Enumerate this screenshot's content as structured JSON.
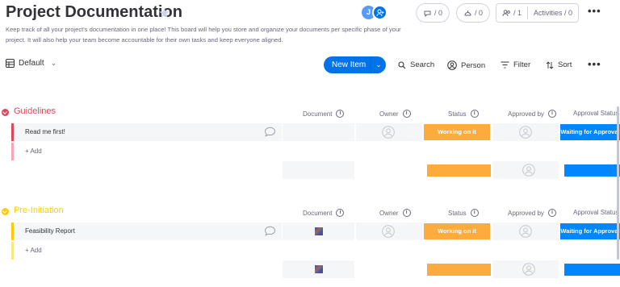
{
  "board": {
    "title": "Project Documentation",
    "description": "Keep track of all your project's documentation in one place! This board will help you store and organize your documents per specific phase of your project. It will also help your team become accountable for their own tasks and keep everyone aligned."
  },
  "header": {
    "avatar_initial": "J",
    "updates_count": "/ 0",
    "integrations_count": "/ 0",
    "members_count": "/ 1",
    "activities_label": "Activities / 0",
    "more": "•••"
  },
  "toolbar": {
    "view_label": "Default",
    "new_item": "New Item",
    "search": "Search",
    "person": "Person",
    "filter": "Filter",
    "sort": "Sort",
    "more": "•••"
  },
  "columns": {
    "document": "Document",
    "owner": "Owner",
    "status": "Status",
    "approved_by": "Approved by",
    "approval_status": "Approval Status"
  },
  "groups": [
    {
      "name": "Guidelines",
      "color": "#e2445c",
      "items": [
        {
          "name": "Read me first!",
          "status": "Working on it",
          "approval_status": "Waiting for Approval",
          "has_document": false
        }
      ],
      "add_label": "+ Add"
    },
    {
      "name": "Pre-Initiation",
      "color": "#ffcb00",
      "items": [
        {
          "name": "Feasibility Report",
          "status": "Working on it",
          "approval_status": "Waiting for Approval",
          "has_document": true
        }
      ],
      "add_label": "+ Add"
    }
  ],
  "colors": {
    "working_on_it": "#fdab3d",
    "waiting_for_approval": "#0086ff",
    "primary": "#0073ea"
  }
}
